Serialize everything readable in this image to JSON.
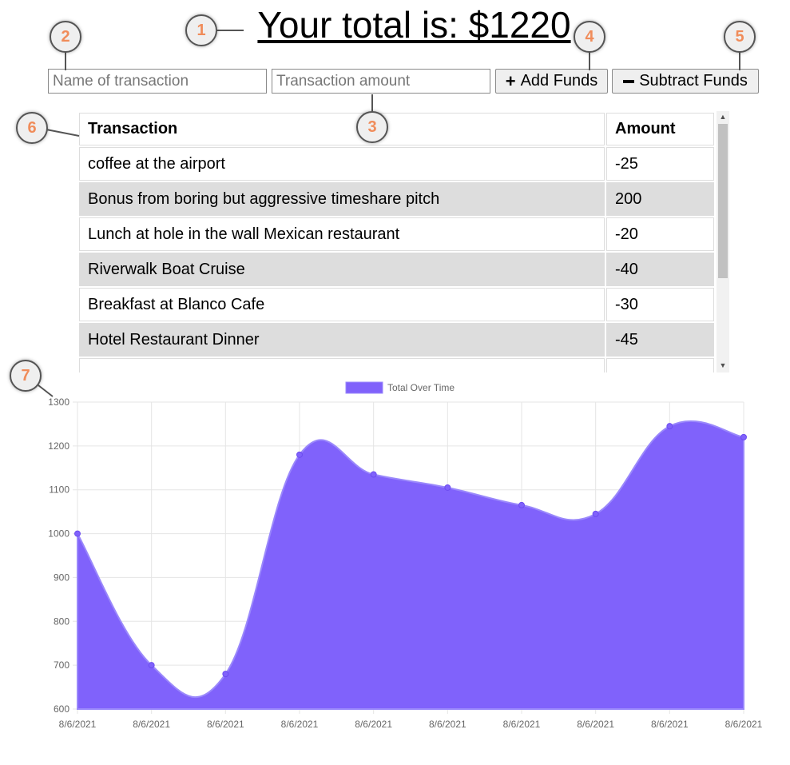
{
  "header": {
    "title": "Your total is: $1220"
  },
  "form": {
    "name_placeholder": "Name of transaction",
    "amount_placeholder": "Transaction amount",
    "add_label": "Add Funds",
    "subtract_label": "Subtract Funds"
  },
  "table": {
    "headers": [
      "Transaction",
      "Amount"
    ],
    "rows": [
      {
        "name": "coffee at the airport",
        "amount": "-25"
      },
      {
        "name": "Bonus from boring but aggressive timeshare pitch",
        "amount": "200"
      },
      {
        "name": "Lunch at hole in the wall Mexican restaurant",
        "amount": "-20"
      },
      {
        "name": "Riverwalk Boat Cruise",
        "amount": "-40"
      },
      {
        "name": "Breakfast at Blanco Cafe",
        "amount": "-30"
      },
      {
        "name": "Hotel Restaurant Dinner",
        "amount": "-45"
      }
    ]
  },
  "callouts": [
    "1",
    "2",
    "3",
    "4",
    "5",
    "6",
    "7"
  ],
  "icons": {
    "add": "plus-icon",
    "subtract": "minus-icon"
  },
  "colors": {
    "area_fill": "#8062fb",
    "callout_number": "#f08c5a"
  },
  "chart_data": {
    "type": "area",
    "legend": "Total Over Time",
    "legend_position": "top",
    "x": [
      "8/6/2021",
      "8/6/2021",
      "8/6/2021",
      "8/6/2021",
      "8/6/2021",
      "8/6/2021",
      "8/6/2021",
      "8/6/2021",
      "8/6/2021",
      "8/6/2021"
    ],
    "values": [
      1000,
      700,
      680,
      1180,
      1135,
      1105,
      1065,
      1045,
      1245,
      1220
    ],
    "ylim": [
      600,
      1300
    ],
    "yticks": [
      600,
      700,
      800,
      900,
      1000,
      1100,
      1200,
      1300
    ],
    "grid": true
  }
}
